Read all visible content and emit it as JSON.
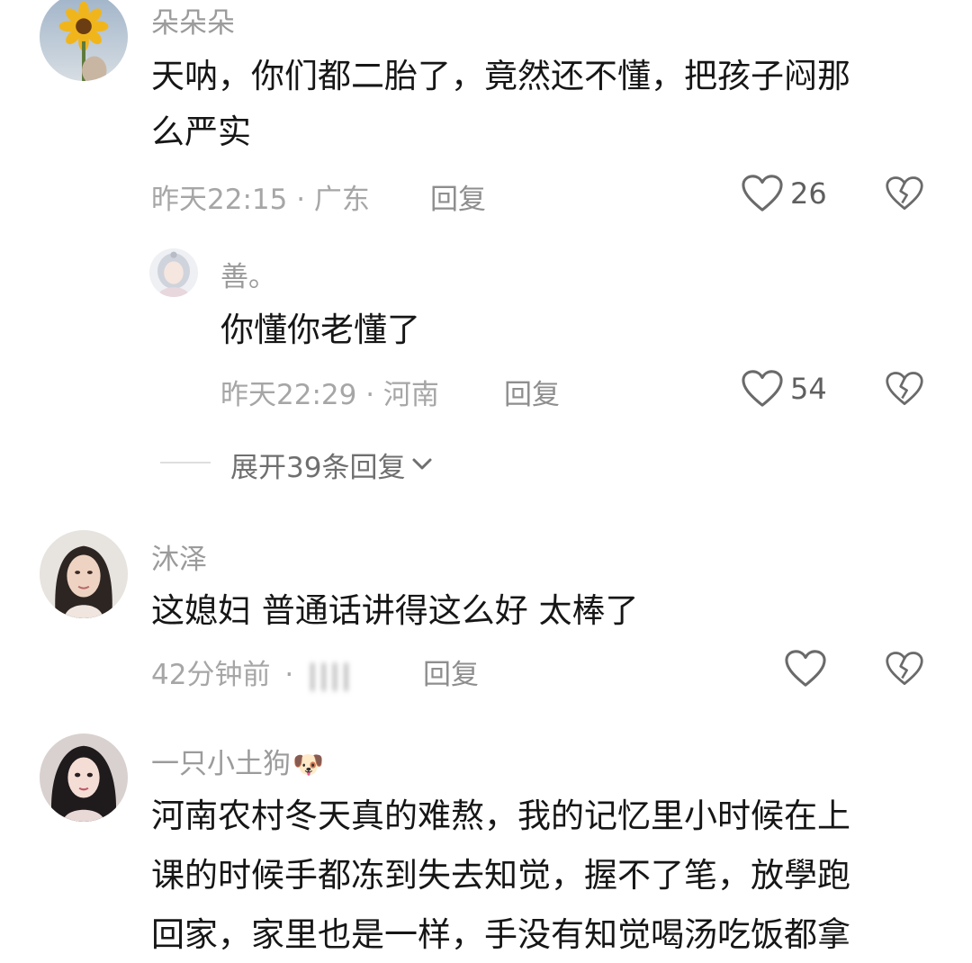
{
  "comments": [
    {
      "user": "朵朵朵",
      "text_lines": [
        "天呐，你们都二胎了，竟然还不懂，把孩子闷那",
        "么严实"
      ],
      "meta": "昨天22:15 · 广东",
      "reply_label": "回复",
      "likes": "26",
      "avatar_icon": "sunflower-avatar",
      "sub_reply": {
        "user": "善。",
        "text": "你懂你老懂了",
        "meta": "昨天22:29 · 河南",
        "reply_label": "回复",
        "likes": "54",
        "avatar_icon": "anime-girl-avatar"
      },
      "expand_label": "展开39条回复"
    },
    {
      "user": "沐泽",
      "text": "这媳妇 普通话讲得这么好 太棒了",
      "meta_time": "42分钟前",
      "meta_sep": "·",
      "meta_location_blurred": "||||",
      "reply_label": "回复",
      "avatar_icon": "woman-portrait-avatar"
    },
    {
      "user": "一只小土狗",
      "user_emoji": "🐶",
      "text_lines": [
        "河南农村冬天真的难熬，我的记忆里小时候在上",
        "课的时候手都冻到失去知觉，握不了笔，放學跑",
        "回家，家里也是一样，手没有知觉喝汤吃饭都拿"
      ],
      "avatar_icon": "illustrated-girl-avatar"
    }
  ],
  "icons": {
    "like": "heart-outline-icon",
    "dislike": "broken-heart-icon",
    "expand": "chevron-down-icon"
  }
}
